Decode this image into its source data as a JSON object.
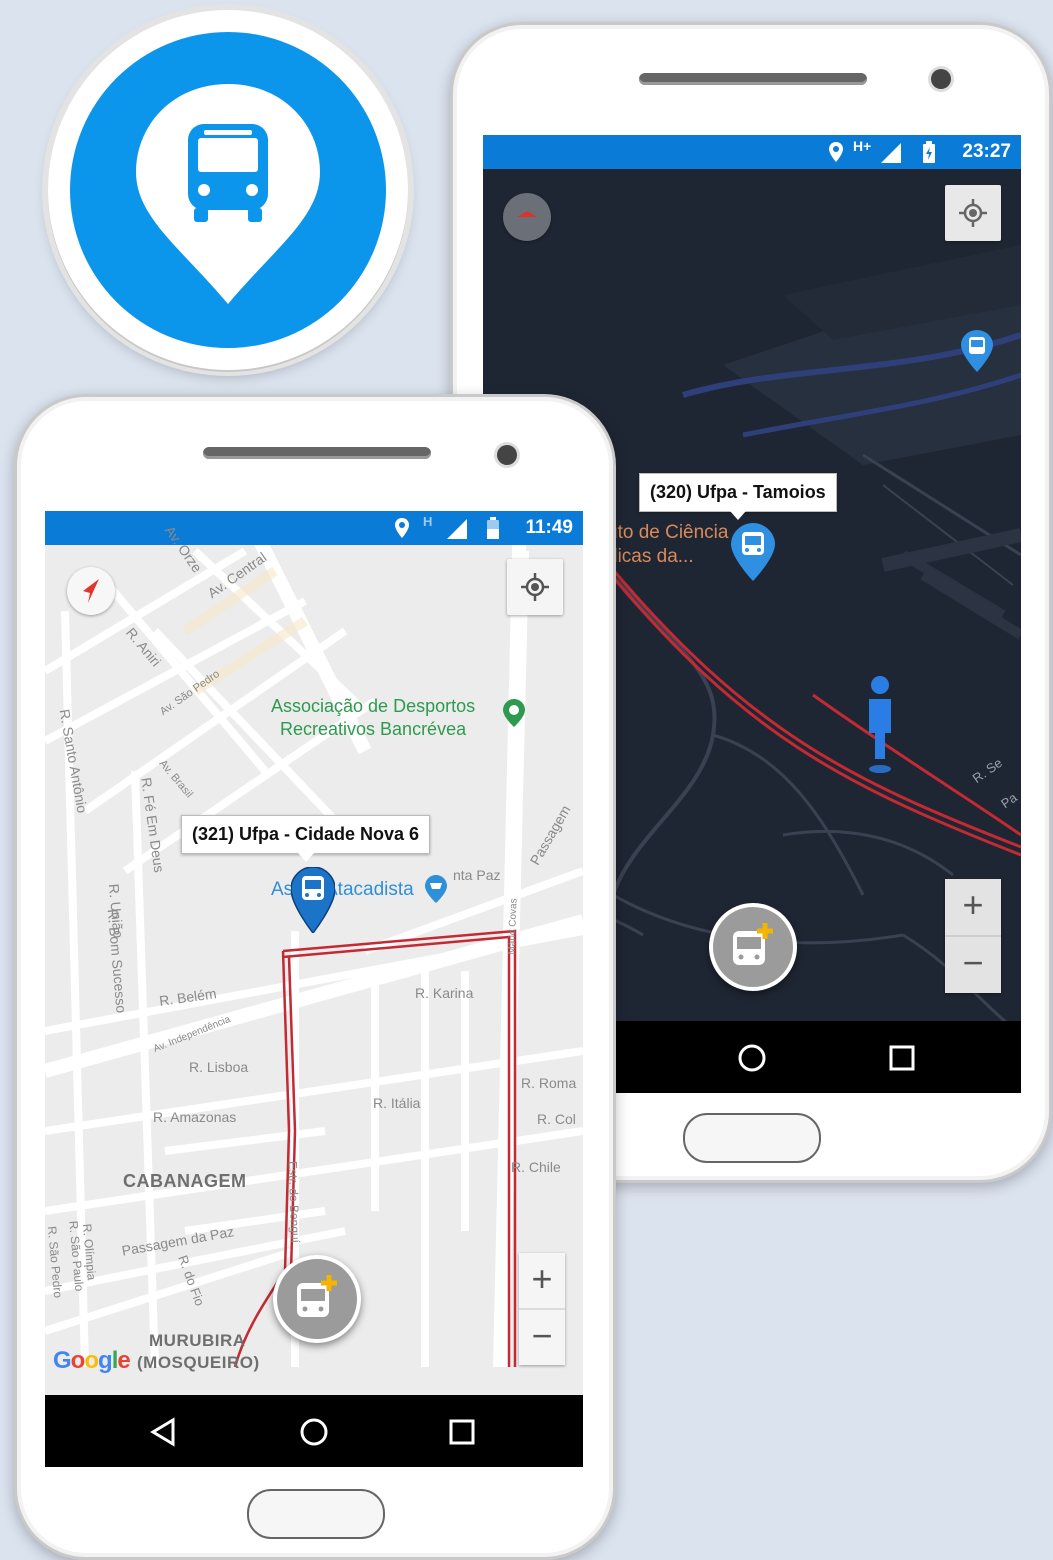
{
  "icon": {
    "name": "bus-location-pin-icon",
    "color": "#0b96ec"
  },
  "back_phone": {
    "status": {
      "network": "H+",
      "time": "23:27"
    },
    "map_theme": "dark",
    "tooltip": "(320) Ufpa - Tamoios",
    "poi_text": [
      "uto de Ciência",
      "dicas da..."
    ],
    "streets": [
      "R. Se",
      "Pa"
    ],
    "zoom": {
      "in": "+",
      "out": "−"
    },
    "colors": {
      "map_bg": "#1f2633",
      "route": "#c32a33",
      "marker": "#2f8fe0",
      "status_bar": "#0b7bd8"
    }
  },
  "front_phone": {
    "status": {
      "network": "H",
      "time": "11:49"
    },
    "map_theme": "light",
    "tooltip": "(321) Ufpa - Cidade Nova 6",
    "poi_green": [
      "Associação de Desportos",
      "Recreativos Bancrévea"
    ],
    "poi_blue": "Atacadista",
    "poi_blue_prefix": "As",
    "streets": {
      "orze": "Av. Orze",
      "central": "Av. Central",
      "aniri": "R. Aniri",
      "sao_pedro": "Av. São Pedro",
      "santo_antonio": "R. Santo Antônio",
      "brasil": "Av. Brasil",
      "fe_em_deus": "R. Fé Em Deus",
      "uniao": "R. União",
      "bom_sucesso": "R. Bom Sucesso",
      "belem": "R. Belém",
      "independencia": "Av. Independência",
      "lisboa": "R. Lisboa",
      "amazonas": "R. Amazonas",
      "karina": "R. Karina",
      "italia": "R. Itália",
      "roma": "R. Roma",
      "col": "R. Col",
      "chile": "R. Chile",
      "passagem": "Passagem",
      "mario_covas": "Mário Covas",
      "paz": "nta Paz",
      "passagem_da_paz": "Passagem da Paz",
      "olimpia": "R. Olímpia",
      "sao_paulo": "R. São Paulo",
      "sao_pedro_r": "R. São Pedro",
      "do_fio": "R. do Fio",
      "estrada_bengui": "Estr. do Benguí"
    },
    "districts": {
      "cabanagem": "CABANAGEM",
      "murubira": "MURUBIRA",
      "mosqueiro": "(MOSQUEIRO)"
    },
    "google": "Google",
    "zoom": {
      "in": "+",
      "out": "−"
    },
    "colors": {
      "map_bg": "#ececec",
      "route": "#c32a33",
      "marker": "#1b74c8",
      "green": "#2e9a4f"
    }
  }
}
